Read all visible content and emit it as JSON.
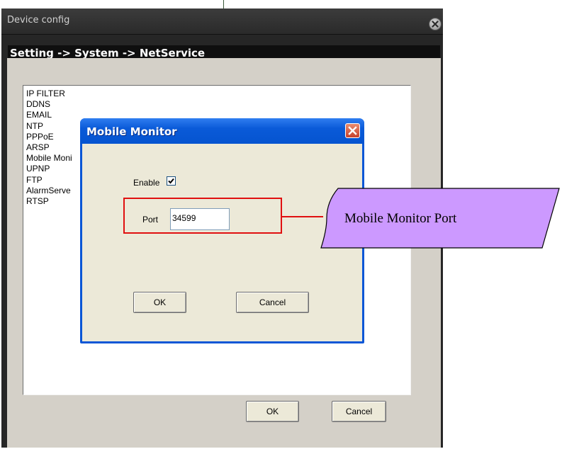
{
  "window": {
    "title": "Device config",
    "breadcrumb": "Setting -> System -> NetService"
  },
  "service_list": [
    "IP FILTER",
    "DDNS",
    "EMAIL",
    "NTP",
    "PPPoE",
    "ARSP",
    "Mobile Moni",
    "UPNP",
    "FTP",
    "AlarmServe",
    "RTSP"
  ],
  "main_buttons": {
    "ok": "OK",
    "cancel": "Cancel"
  },
  "dialog": {
    "title": "Mobile Monitor",
    "enable_label": "Enable",
    "enable_checked": true,
    "port_label": "Port",
    "port_value": "34599",
    "ok": "OK",
    "cancel": "Cancel"
  },
  "annotation": {
    "callout_text": "Mobile Monitor Port",
    "callout_fill": "#cc99ff",
    "highlight_color": "#e01010"
  },
  "colors": {
    "window_bg": "#262626",
    "dialog_titlebar": "#0a5ad8",
    "dialog_body": "#ece9d8"
  }
}
